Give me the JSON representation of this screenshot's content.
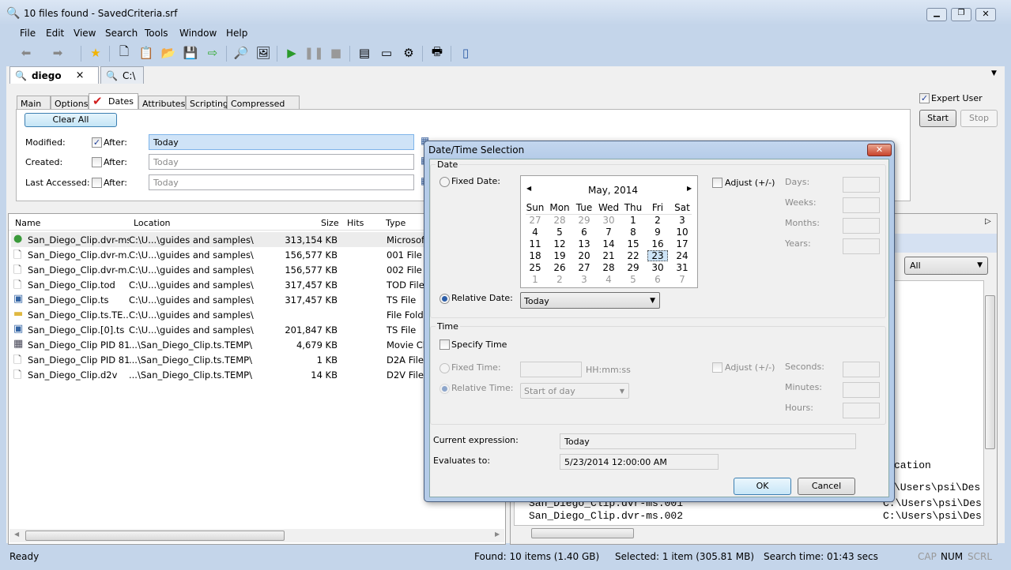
{
  "window": {
    "title": "10 files found - SavedCriteria.srf"
  },
  "menu": [
    "File",
    "Edit",
    "View",
    "Search",
    "Tools",
    "Window",
    "Help"
  ],
  "tabs": [
    {
      "label": "diego",
      "close": "×"
    },
    {
      "label": "C:\\"
    }
  ],
  "subtabs": [
    "Main",
    "Options",
    "Dates",
    "Attributes",
    "Scripting",
    "Compressed Files"
  ],
  "criteria": {
    "clear_all": "Clear All",
    "expert_user": "Expert User",
    "start": "Start",
    "stop": "Stop",
    "rows": [
      {
        "label": "Modified:",
        "after": "After:",
        "checked": true,
        "value": "Today"
      },
      {
        "label": "Created:",
        "after": "After:",
        "checked": false,
        "value": "Today"
      },
      {
        "label": "Last Accessed:",
        "after": "After:",
        "checked": false,
        "value": "Today"
      }
    ]
  },
  "results": {
    "columns": [
      "Name",
      "Location",
      "Size",
      "Hits",
      "Type"
    ],
    "rows": [
      {
        "name": "San_Diego_Clip.dvr-ms",
        "location": "C:\\U...\\guides and samples\\",
        "size": "313,154 KB",
        "type": "Microsof",
        "icon": "media-icon"
      },
      {
        "name": "San_Diego_Clip.dvr-m...",
        "location": "C:\\U...\\guides and samples\\",
        "size": "156,577 KB",
        "type": "001 File",
        "icon": "file-icon"
      },
      {
        "name": "San_Diego_Clip.dvr-m...",
        "location": "C:\\U...\\guides and samples\\",
        "size": "156,577 KB",
        "type": "002 File",
        "icon": "file-icon"
      },
      {
        "name": "San_Diego_Clip.tod",
        "location": "C:\\U...\\guides and samples\\",
        "size": "317,457 KB",
        "type": "TOD File",
        "icon": "file-icon"
      },
      {
        "name": "San_Diego_Clip.ts",
        "location": "C:\\U...\\guides and samples\\",
        "size": "317,457 KB",
        "type": "TS File",
        "icon": "video-icon"
      },
      {
        "name": "San_Diego_Clip.ts.TE...",
        "location": "C:\\U...\\guides and samples\\",
        "size": "",
        "type": "File Folde",
        "icon": "folder-icon"
      },
      {
        "name": "San_Diego_Clip.[0].ts",
        "location": "C:\\U...\\guides and samples\\",
        "size": "201,847 KB",
        "type": "TS File",
        "icon": "video-icon"
      },
      {
        "name": "San_Diego_Clip PID 81...",
        "location": "...\\San_Diego_Clip.ts.TEMP\\",
        "size": "4,679 KB",
        "type": "Movie Cl",
        "icon": "movie-icon"
      },
      {
        "name": "San_Diego_Clip PID 81...",
        "location": "...\\San_Diego_Clip.ts.TEMP\\",
        "size": "1 KB",
        "type": "D2A File",
        "icon": "file-icon"
      },
      {
        "name": "San_Diego_Clip.d2v",
        "location": "...\\San_Diego_Clip.ts.TEMP\\",
        "size": "14 KB",
        "type": "D2V File",
        "icon": "file-icon"
      }
    ]
  },
  "preview": {
    "filter": "All",
    "lines": [
      {
        "left": "",
        "right": "cation"
      },
      {
        "left": "",
        "right": "\\Users\\psi\\Des"
      },
      {
        "left": "San_Diego_Clip.dvr-ms.001",
        "right": "C:\\Users\\psi\\Des"
      },
      {
        "left": "San_Diego_Clip.dvr-ms.002",
        "right": "C:\\Users\\psi\\Des"
      }
    ]
  },
  "dialog": {
    "title": "Date/Time Selection",
    "date_group": "Date",
    "fixed_date": "Fixed Date:",
    "month": "May, 2014",
    "weekdays": [
      "Sun",
      "Mon",
      "Tue",
      "Wed",
      "Thu",
      "Fri",
      "Sat"
    ],
    "weeks": [
      [
        27,
        28,
        29,
        30,
        1,
        2,
        3
      ],
      [
        4,
        5,
        6,
        7,
        8,
        9,
        10
      ],
      [
        11,
        12,
        13,
        14,
        15,
        16,
        17
      ],
      [
        18,
        19,
        20,
        21,
        22,
        23,
        24
      ],
      [
        25,
        26,
        27,
        28,
        29,
        30,
        31
      ],
      [
        1,
        2,
        3,
        4,
        5,
        6,
        7
      ]
    ],
    "selected_day": 23,
    "adjust": "Adjust (+/-)",
    "date_units": [
      "Days:",
      "Weeks:",
      "Months:",
      "Years:"
    ],
    "relative_date": "Relative Date:",
    "relative_date_value": "Today",
    "time_group": "Time",
    "specify_time": "Specify Time",
    "fixed_time": "Fixed Time:",
    "time_format": "HH:mm:ss",
    "relative_time": "Relative Time:",
    "relative_time_value": "Start of day",
    "time_units": [
      "Seconds:",
      "Minutes:",
      "Hours:"
    ],
    "current_expression_label": "Current expression:",
    "current_expression": "Today",
    "evaluates_label": "Evaluates to:",
    "evaluates": "5/23/2014 12:00:00 AM",
    "ok": "OK",
    "cancel": "Cancel"
  },
  "status": {
    "ready": "Ready",
    "found": "Found: 10 items (1.40 GB)",
    "selected": "Selected: 1 item (305.81 MB)",
    "search_time": "Search time: 01:43 secs",
    "cap": "CAP",
    "num": "NUM",
    "scrl": "SCRL"
  }
}
